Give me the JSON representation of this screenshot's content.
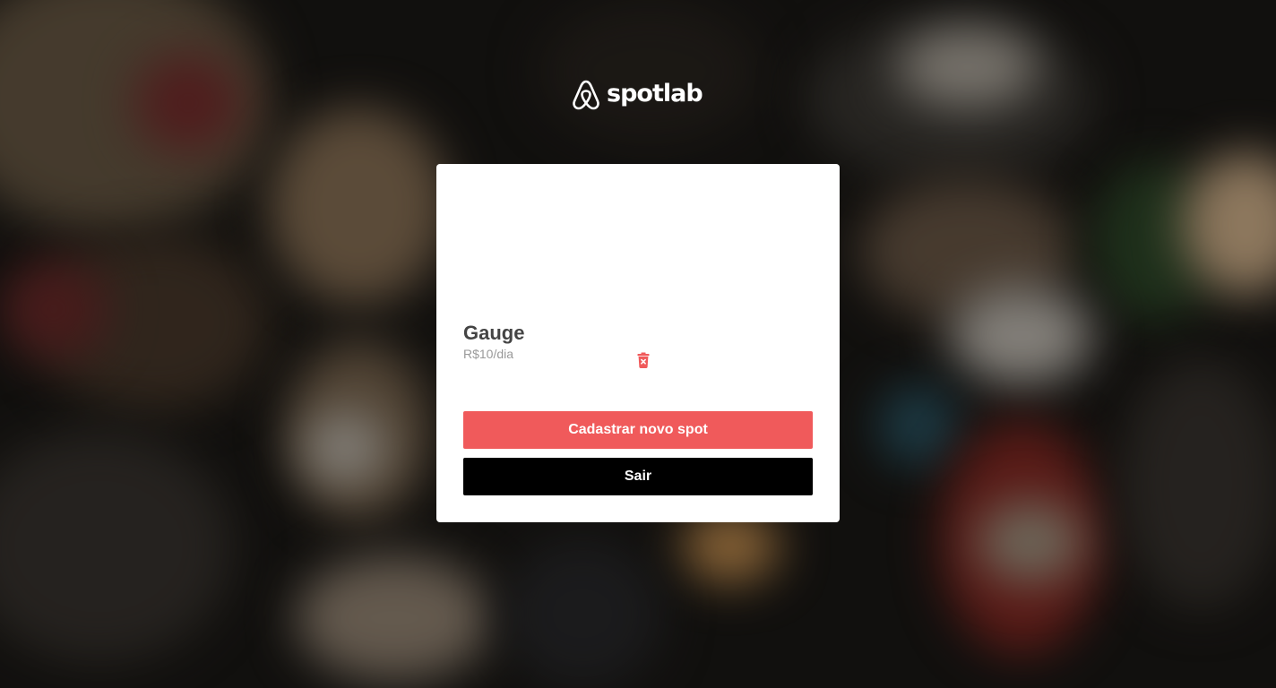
{
  "brand": {
    "name": "spotlab",
    "logo_icon": "airbnb-belo-icon"
  },
  "spots": [
    {
      "title": "Gauge",
      "price": "R$10/dia",
      "delete_icon": "trash-icon"
    }
  ],
  "actions": {
    "new_spot_label": "Cadastrar novo spot",
    "logout_label": "Sair"
  },
  "colors": {
    "primary": "#f05a5b",
    "secondary": "#000000",
    "card": "#ffffff",
    "title_text": "#444444",
    "price_text": "#999999"
  }
}
